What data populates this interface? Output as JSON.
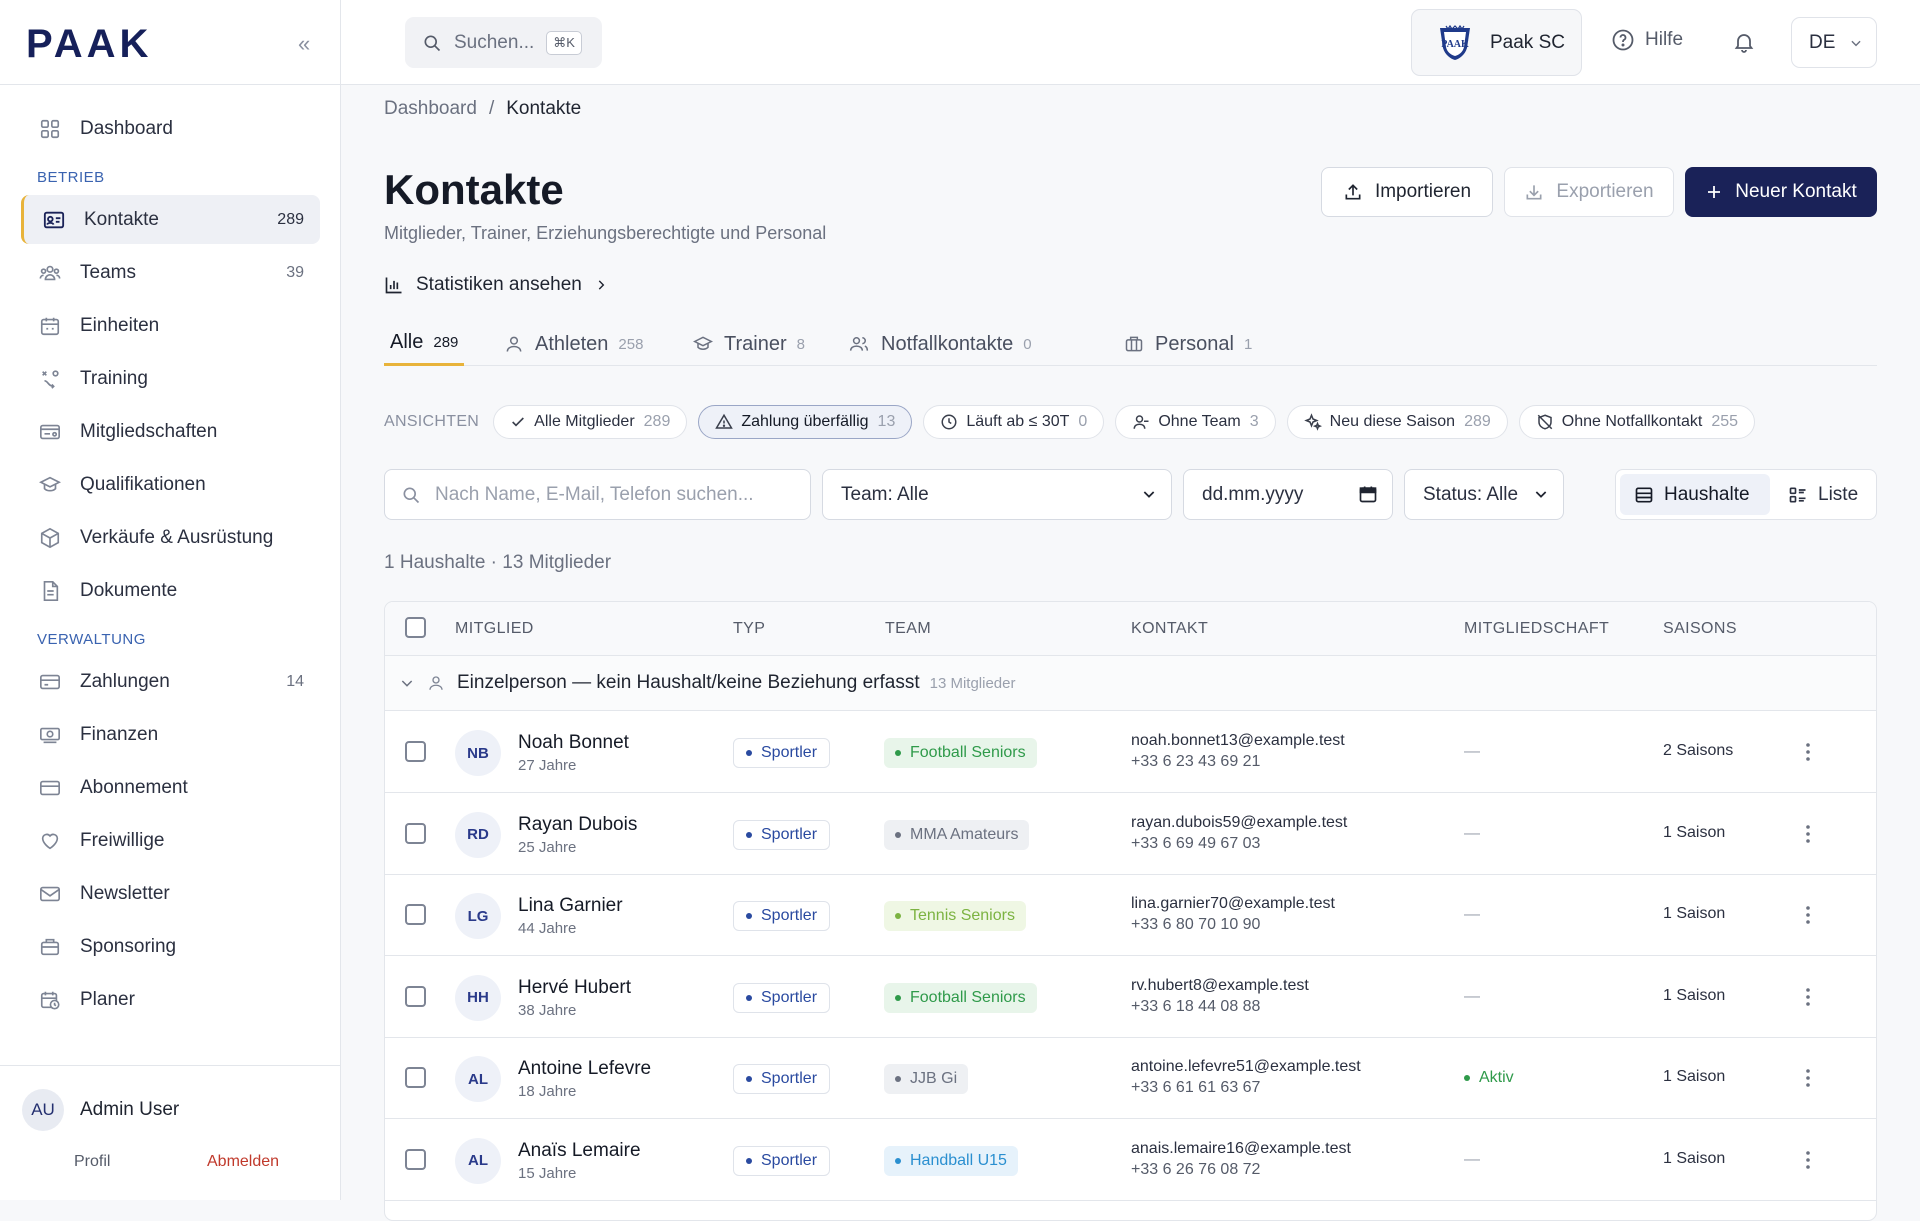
{
  "app": {
    "logo": "PAAK",
    "collapse_icon": "double-chevron-left-icon"
  },
  "sidebar": {
    "items_top": [
      {
        "label": "Dashboard",
        "icon": "grid-icon",
        "count": ""
      }
    ],
    "section_betrieb": "BETRIEB",
    "items_betrieb": [
      {
        "label": "Kontakte",
        "icon": "id-card-icon",
        "count": "289",
        "active": true
      },
      {
        "label": "Teams",
        "icon": "group-icon",
        "count": "39"
      },
      {
        "label": "Einheiten",
        "icon": "calendar-icon",
        "count": ""
      },
      {
        "label": "Training",
        "icon": "drill-icon",
        "count": ""
      },
      {
        "label": "Mitgliedschaften",
        "icon": "membership-card-icon",
        "count": ""
      },
      {
        "label": "Qualifikationen",
        "icon": "graduation-cap-icon",
        "count": ""
      },
      {
        "label": "Verkäufe & Ausrüstung",
        "icon": "box-icon",
        "count": ""
      },
      {
        "label": "Dokumente",
        "icon": "document-icon",
        "count": ""
      }
    ],
    "section_verwaltung": "VERWALTUNG",
    "items_verwaltung": [
      {
        "label": "Zahlungen",
        "icon": "credit-card-icon",
        "count": "14"
      },
      {
        "label": "Finanzen",
        "icon": "banknote-icon",
        "count": ""
      },
      {
        "label": "Abonnement",
        "icon": "card-icon",
        "count": ""
      },
      {
        "label": "Freiwillige",
        "icon": "heart-icon",
        "count": ""
      },
      {
        "label": "Newsletter",
        "icon": "mail-icon",
        "count": ""
      },
      {
        "label": "Sponsoring",
        "icon": "briefcase-icon",
        "count": ""
      },
      {
        "label": "Planer",
        "icon": "calendar-clock-icon",
        "count": ""
      }
    ],
    "user": {
      "initials": "AU",
      "name": "Admin User",
      "profile": "Profil",
      "logout": "Abmelden"
    }
  },
  "topbar": {
    "search_label": "Suchen...",
    "search_shortcut": "⌘K",
    "club_name": "Paak SC",
    "help": "Hilfe",
    "lang": "DE"
  },
  "breadcrumb": {
    "root": "Dashboard",
    "sep": "/",
    "current": "Kontakte"
  },
  "header": {
    "title": "Kontakte",
    "subtitle": "Mitglieder, Trainer, Erziehungsberechtigte und Personal",
    "import": "Importieren",
    "export": "Exportieren",
    "new": "Neuer Kontakt",
    "stats_link": "Statistiken ansehen"
  },
  "tabs": [
    {
      "label": "Alle",
      "count": "289",
      "icon": ""
    },
    {
      "label": "Athleten",
      "count": "258",
      "icon": "user-icon"
    },
    {
      "label": "Trainer",
      "count": "8",
      "icon": "graduation-cap-icon"
    },
    {
      "label": "Notfallkontakte",
      "count": "0",
      "icon": "users-icon"
    },
    {
      "label": "Personal",
      "count": "1",
      "icon": "briefcase-icon"
    }
  ],
  "views": {
    "label": "ANSICHTEN",
    "chips": [
      {
        "label": "Alle Mitglieder",
        "count": "289",
        "icon": "check-icon"
      },
      {
        "label": "Zahlung überfällig",
        "count": "13",
        "icon": "warning-icon",
        "selected": true
      },
      {
        "label": "Läuft ab ≤ 30T",
        "count": "0",
        "icon": "clock-icon"
      },
      {
        "label": "Ohne Team",
        "count": "3",
        "icon": "user-minus-icon"
      },
      {
        "label": "Neu diese Saison",
        "count": "289",
        "icon": "sparkle-icon"
      },
      {
        "label": "Ohne Notfallkontakt",
        "count": "255",
        "icon": "shield-off-icon"
      }
    ]
  },
  "filters": {
    "search_placeholder": "Nach Name, E-Mail, Telefon suchen...",
    "team": "Team: Alle",
    "date_placeholder": "dd.mm.yyyy",
    "status": "Status: Alle",
    "view_households": "Haushalte",
    "view_list": "Liste"
  },
  "summary": "1 Haushalte · 13 Mitglieder",
  "table": {
    "headers": {
      "member": "MITGLIED",
      "type": "TYP",
      "team": "TEAM",
      "contact": "KONTAKT",
      "membership": "MITGLIEDSCHAFT",
      "seasons": "SAISONS"
    },
    "group": {
      "label": "Einzelperson — kein Haushalt/keine Beziehung erfasst",
      "count": "13 Mitglieder"
    },
    "rows": [
      {
        "initials": "NB",
        "name": "Noah Bonnet",
        "age": "27 Jahre",
        "type": "Sportler",
        "team": "Football Seniors",
        "team_color": "#2f9a4a",
        "team_bg": "#e8f5ea",
        "email": "noah.bonnet13@example.test",
        "phone": "+33 6 23 43 69 21",
        "membership": "—",
        "seasons": "2 Saisons"
      },
      {
        "initials": "RD",
        "name": "Rayan Dubois",
        "age": "25 Jahre",
        "type": "Sportler",
        "team": "MMA Amateurs",
        "team_color": "#6b7180",
        "team_bg": "#eef0f3",
        "email": "rayan.dubois59@example.test",
        "phone": "+33 6 69 49 67 03",
        "membership": "—",
        "seasons": "1 Saison"
      },
      {
        "initials": "LG",
        "name": "Lina Garnier",
        "age": "44 Jahre",
        "type": "Sportler",
        "team": "Tennis Seniors",
        "team_color": "#7cb342",
        "team_bg": "#eff7e4",
        "email": "lina.garnier70@example.test",
        "phone": "+33 6 80 70 10 90",
        "membership": "—",
        "seasons": "1 Saison"
      },
      {
        "initials": "HH",
        "name": "Hervé Hubert",
        "age": "38 Jahre",
        "type": "Sportler",
        "team": "Football Seniors",
        "team_color": "#2f9a4a",
        "team_bg": "#e8f5ea",
        "email": "rv.hubert8@example.test",
        "phone": "+33 6 18 44 08 88",
        "membership": "—",
        "seasons": "1 Saison"
      },
      {
        "initials": "AL",
        "name": "Antoine Lefevre",
        "age": "18 Jahre",
        "type": "Sportler",
        "team": "JJB Gi",
        "team_color": "#6b7180",
        "team_bg": "#eef0f3",
        "email": "antoine.lefevre51@example.test",
        "phone": "+33 6 61 61 63 67",
        "membership": "Aktiv",
        "seasons": "1 Saison"
      },
      {
        "initials": "AL",
        "name": "Anaïs Lemaire",
        "age": "15 Jahre",
        "type": "Sportler",
        "team": "Handball U15",
        "team_color": "#2a8fd0",
        "team_bg": "#e6f2fb",
        "email": "anais.lemaire16@example.test",
        "phone": "+33 6 26 76 08 72",
        "membership": "—",
        "seasons": "1 Saison"
      }
    ]
  },
  "colors": {
    "brand": "#1a2258",
    "accent": "#e8b33a",
    "active_green": "#2f9a4a"
  }
}
